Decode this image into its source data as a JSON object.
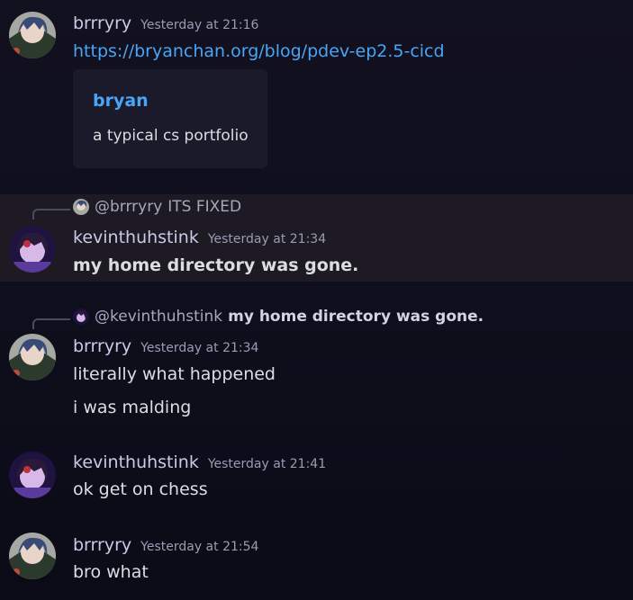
{
  "messages": [
    {
      "username": "brrryry",
      "timestamp": "Yesterday at 21:16",
      "link": "https://bryanchan.org/blog/pdev-ep2.5-cicd",
      "embed": {
        "title": "bryan",
        "description": "a typical cs portfolio"
      }
    },
    {
      "reply": {
        "mention": "@brrryry",
        "content": "ITS FIXED"
      },
      "username": "kevinthuhstink",
      "timestamp": "Yesterday at 21:34",
      "lines": [
        "my home directory was gone."
      ]
    },
    {
      "reply": {
        "mention": "@kevinthuhstink",
        "content": "my home directory was gone."
      },
      "username": "brrryry",
      "timestamp": "Yesterday at 21:34",
      "lines": [
        "literally what happened",
        "i was malding"
      ]
    },
    {
      "username": "kevinthuhstink",
      "timestamp": "Yesterday at 21:41",
      "lines": [
        "ok get on chess"
      ]
    },
    {
      "username": "brrryry",
      "timestamp": "Yesterday at 21:54",
      "lines": [
        "bro what"
      ]
    }
  ],
  "colors": {
    "background": "#0f0f1c",
    "link": "#49a5f5",
    "username": "#c8cbe6",
    "highlight": "#1d1a24"
  }
}
